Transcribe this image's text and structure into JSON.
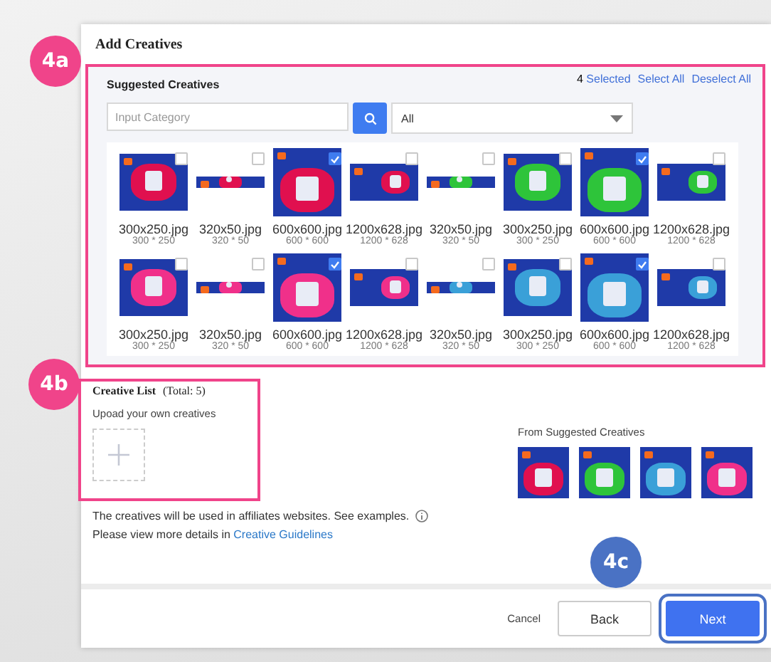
{
  "dialog": {
    "title": "Add Creatives"
  },
  "suggested": {
    "badge": {
      "label": "4a",
      "color": "#f0448a"
    },
    "title": "Suggested Creatives",
    "selected_count": "4",
    "selected_label": "Selected",
    "select_all": "Select All",
    "deselect_all": "Deselect All",
    "search": {
      "placeholder": "Input Category"
    },
    "category": {
      "value": "All"
    },
    "creatives": [
      {
        "file": "300x250.jpg",
        "size": "300 * 250",
        "kind": "medium",
        "color": "#e0104f",
        "selected": false
      },
      {
        "file": "320x50.jpg",
        "size": "320 * 50",
        "kind": "strip",
        "color": "#e0104f",
        "selected": false
      },
      {
        "file": "600x600.jpg",
        "size": "600 * 600",
        "kind": "square",
        "color": "#e0104f",
        "selected": true
      },
      {
        "file": "1200x628.jpg",
        "size": "1200 * 628",
        "kind": "landscape",
        "color": "#e0104f",
        "selected": false
      },
      {
        "file": "320x50.jpg",
        "size": "320 * 50",
        "kind": "strip",
        "color": "#2ec43a",
        "selected": false
      },
      {
        "file": "300x250.jpg",
        "size": "300 * 250",
        "kind": "medium",
        "color": "#2ec43a",
        "selected": false
      },
      {
        "file": "600x600.jpg",
        "size": "600 * 600",
        "kind": "square",
        "color": "#2ec43a",
        "selected": true
      },
      {
        "file": "1200x628.jpg",
        "size": "1200 * 628",
        "kind": "landscape",
        "color": "#2ec43a",
        "selected": false
      },
      {
        "file": "300x250.jpg",
        "size": "300 * 250",
        "kind": "medium",
        "color": "#f0308a",
        "selected": false
      },
      {
        "file": "320x50.jpg",
        "size": "320 * 50",
        "kind": "strip",
        "color": "#f0308a",
        "selected": false
      },
      {
        "file": "600x600.jpg",
        "size": "600 * 600",
        "kind": "square",
        "color": "#f0308a",
        "selected": true
      },
      {
        "file": "1200x628.jpg",
        "size": "1200 * 628",
        "kind": "landscape",
        "color": "#f0308a",
        "selected": false
      },
      {
        "file": "320x50.jpg",
        "size": "320 * 50",
        "kind": "strip",
        "color": "#3aa0d8",
        "selected": false
      },
      {
        "file": "300x250.jpg",
        "size": "300 * 250",
        "kind": "medium",
        "color": "#3aa0d8",
        "selected": false
      },
      {
        "file": "600x600.jpg",
        "size": "600 * 600",
        "kind": "square",
        "color": "#3aa0d8",
        "selected": true
      },
      {
        "file": "1200x628.jpg",
        "size": "1200 * 628",
        "kind": "landscape",
        "color": "#3aa0d8",
        "selected": false
      }
    ]
  },
  "creative_list": {
    "badge": {
      "label": "4b",
      "color": "#f0448a"
    },
    "title": "Creative List",
    "total": "(Total: 5)",
    "upload_label": "Upoad your own creatives",
    "from_label": "From Suggested Creatives",
    "from_creatives": [
      {
        "color": "#e0104f"
      },
      {
        "color": "#2ec43a"
      },
      {
        "color": "#3aa0d8"
      },
      {
        "color": "#f0308a"
      }
    ]
  },
  "notes": {
    "line1": "The creatives will be used in affiliates websites. See examples.",
    "line2": "Please view more details in",
    "link": "Creative Guidelines"
  },
  "footer": {
    "badge": {
      "label": "4c",
      "color": "#4a72c4"
    },
    "cancel": "Cancel",
    "back": "Back",
    "next": "Next"
  }
}
